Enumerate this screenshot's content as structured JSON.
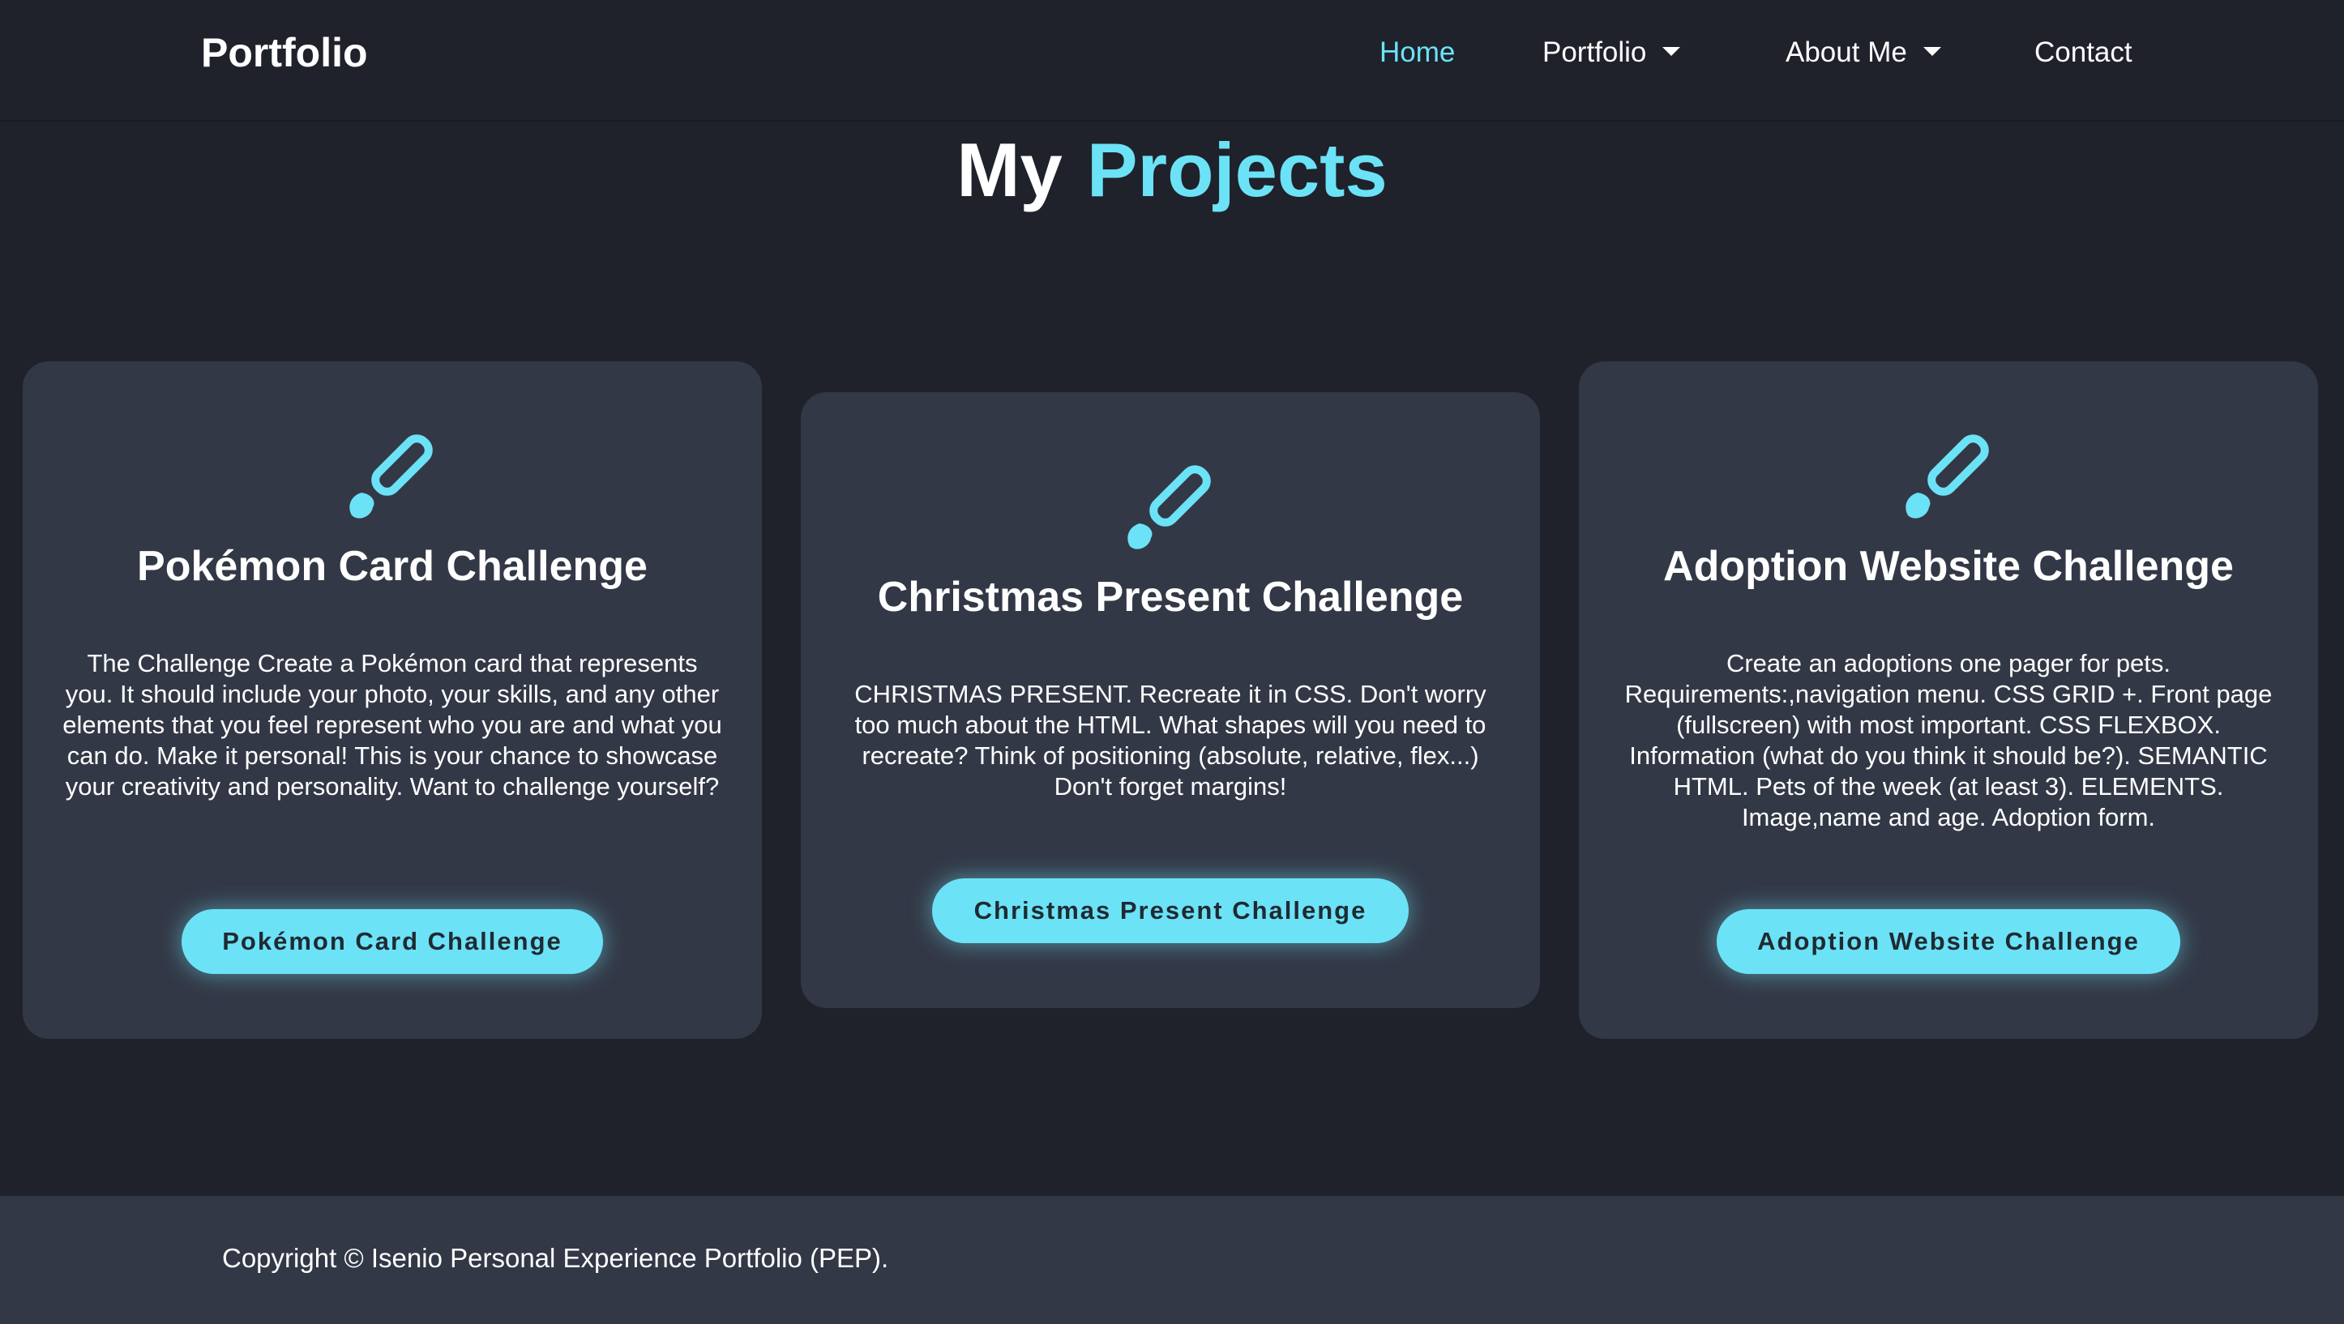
{
  "header": {
    "brand": "Portfolio",
    "nav": {
      "home": "Home",
      "portfolio": "Portfolio",
      "about": "About Me",
      "contact": "Contact"
    },
    "active": "Home"
  },
  "heading": {
    "word1": "My",
    "word2": "Projects"
  },
  "cards": [
    {
      "icon": "paintbrush-icon",
      "title": "Pokémon Card Challenge",
      "description": "The Challenge Create a Pokémon card that represents you. It should include your photo, your skills, and any other elements that you feel represent who you are and what you can do. Make it personal! This is your chance to showcase your creativity and personality. Want to challenge yourself?",
      "button": "Pokémon Card Challenge"
    },
    {
      "icon": "paintbrush-icon",
      "title": "Christmas Present Challenge",
      "description": "CHRISTMAS PRESENT. Recreate it in CSS. Don't worry too much about the HTML. What shapes will you need to recreate? Think of positioning (absolute, relative, flex...) Don't forget margins!",
      "button": "Christmas Present Challenge"
    },
    {
      "icon": "paintbrush-icon",
      "title": "Adoption Website Challenge",
      "description": "Create an adoptions one pager for pets. Requirements:,navigation menu. CSS GRID +. Front page (fullscreen) with most important. CSS FLEXBOX. Information (what do you think it should be?). SEMANTIC HTML. Pets of the week (at least 3). ELEMENTS. Image,name and age. Adoption form.",
      "button": "Adoption Website Challenge"
    }
  ],
  "footer": {
    "copyright": "Copyright © Isenio Personal Experience Portfolio (PEP)."
  },
  "colors": {
    "background": "#1f222b",
    "card": "#333846",
    "accent": "#6ce2f6",
    "text": "#ffffff"
  }
}
